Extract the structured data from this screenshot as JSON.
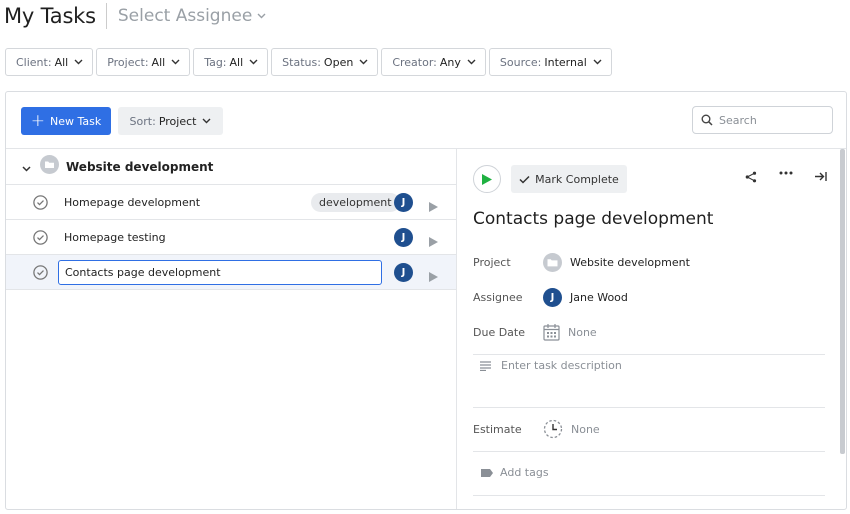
{
  "header": {
    "title": "My Tasks",
    "assignee_select": "Select Assignee"
  },
  "filters": [
    {
      "label": "Client:",
      "value": "All"
    },
    {
      "label": "Project:",
      "value": "All"
    },
    {
      "label": "Tag:",
      "value": "All"
    },
    {
      "label": "Status:",
      "value": "Open"
    },
    {
      "label": "Creator:",
      "value": "Any"
    },
    {
      "label": "Source:",
      "value": "Internal"
    }
  ],
  "toolbar": {
    "new_task_label": "New Task",
    "sort_label": "Sort:",
    "sort_value": "Project",
    "search_placeholder": "Search"
  },
  "task_list": {
    "group": {
      "title": "Website development"
    },
    "tasks": [
      {
        "name": "Homepage development",
        "tag": "development",
        "assignee_initial": "J"
      },
      {
        "name": "Homepage testing",
        "tag": "",
        "assignee_initial": "J"
      },
      {
        "name": "Contacts page development",
        "tag": "",
        "assignee_initial": "J",
        "editing": true
      }
    ]
  },
  "detail": {
    "mark_complete_label": "Mark Complete",
    "title": "Contacts page development",
    "project_label": "Project",
    "project_value": "Website development",
    "assignee_label": "Assignee",
    "assignee_initial": "J",
    "assignee_value": "Jane Wood",
    "due_date_label": "Due Date",
    "due_date_value": "None",
    "description_placeholder": "Enter task description",
    "estimate_label": "Estimate",
    "estimate_value": "None",
    "add_tags_label": "Add tags"
  },
  "colors": {
    "accent": "#2f6fe4",
    "avatar": "#1f4f8f",
    "play_green": "#1fb141"
  }
}
